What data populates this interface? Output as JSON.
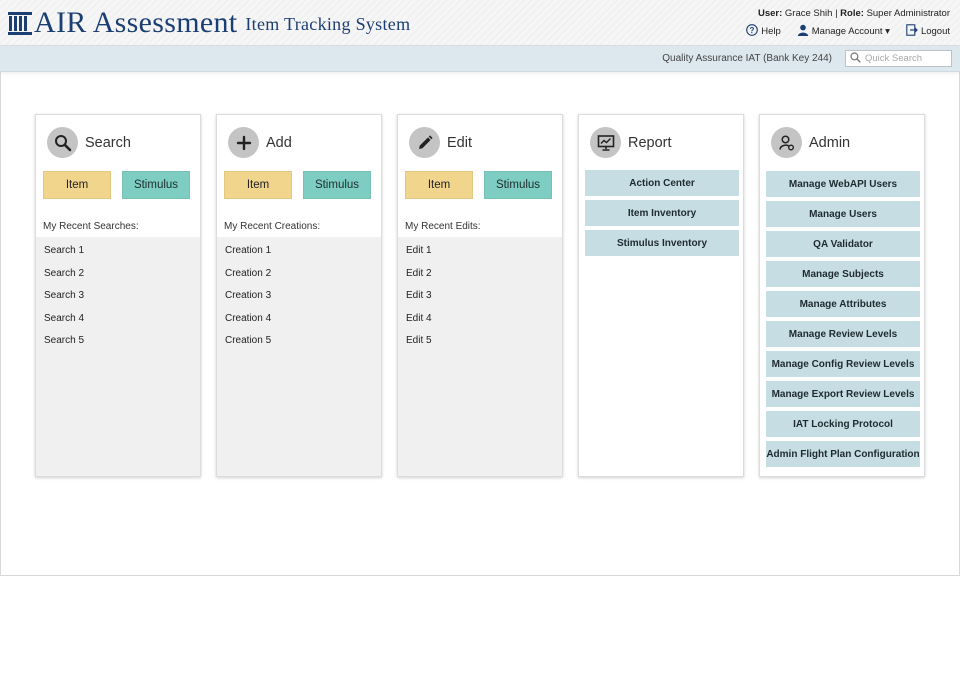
{
  "brand": {
    "name": "AIR Assessment",
    "subtitle": "Item Tracking System"
  },
  "user": {
    "user_label": "User:",
    "user_name": "Grace Shih",
    "separator": "|",
    "role_label": "Role:",
    "role_name": "Super Administrator"
  },
  "toplinks": {
    "help": "Help",
    "manage_account": "Manage Account ▾",
    "logout": "Logout"
  },
  "subbar": {
    "bank_key": "Quality Assurance IAT (Bank Key 244)",
    "quick_search_placeholder": "Quick Search"
  },
  "panels": {
    "search": {
      "title": "Search",
      "item_label": "Item",
      "stimulus_label": "Stimulus",
      "recent_label": "My Recent Searches:",
      "recent": [
        "Search 1",
        "Search 2",
        "Search 3",
        "Search 4",
        "Search 5"
      ]
    },
    "add": {
      "title": "Add",
      "item_label": "Item",
      "stimulus_label": "Stimulus",
      "recent_label": "My Recent Creations:",
      "recent": [
        "Creation 1",
        "Creation 2",
        "Creation 3",
        "Creation 4",
        "Creation 5"
      ]
    },
    "edit": {
      "title": "Edit",
      "item_label": "Item",
      "stimulus_label": "Stimulus",
      "recent_label": "My Recent Edits:",
      "recent": [
        "Edit 1",
        "Edit 2",
        "Edit 3",
        "Edit 4",
        "Edit 5"
      ]
    },
    "report": {
      "title": "Report",
      "links": [
        "Action Center",
        "Item Inventory",
        "Stimulus Inventory"
      ]
    },
    "admin": {
      "title": "Admin",
      "links": [
        "Manage WebAPI Users",
        "Manage Users",
        "QA Validator",
        "Manage Subjects",
        "Manage Attributes",
        "Manage Review Levels",
        "Manage Config Review Levels",
        "Manage Export Review Levels",
        "IAT Locking Protocol",
        "Admin Flight Plan Configuration"
      ]
    }
  },
  "colors": {
    "brand": "#1b3f73",
    "item_button": "#f2d58c",
    "stimulus_button": "#7ecdc3",
    "link_button": "#c6dee3",
    "subbar": "#dde8ee"
  }
}
